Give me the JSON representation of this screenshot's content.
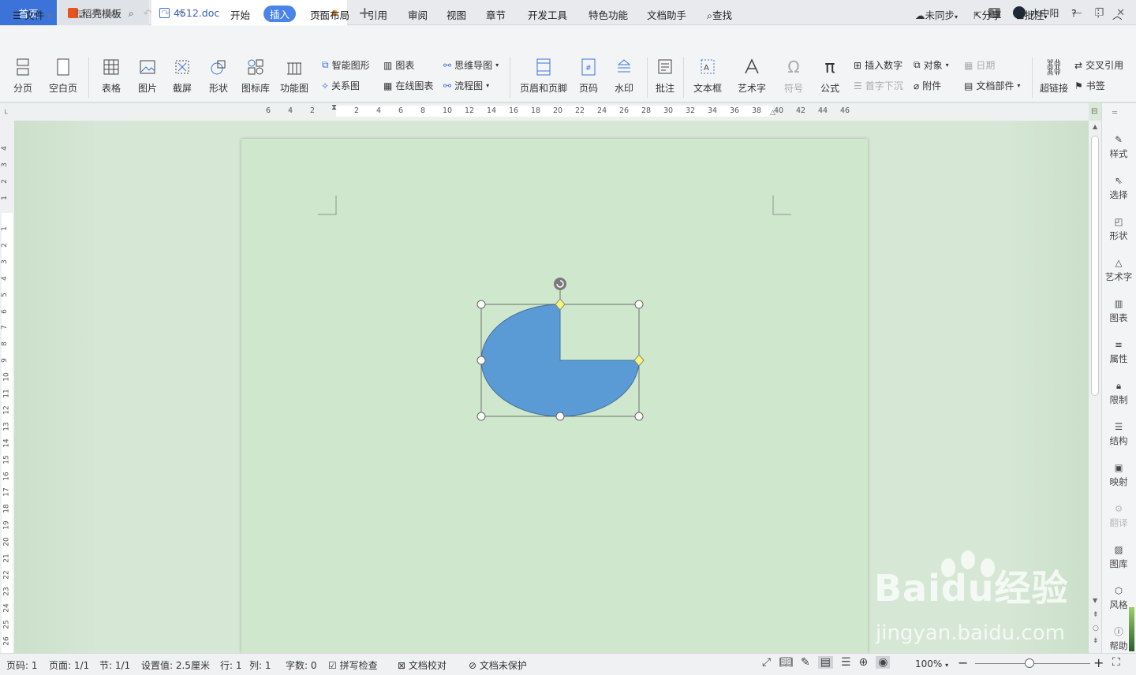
{
  "tabs": {
    "home": "首页",
    "template": "稻壳模板",
    "doc": "4512.doc"
  },
  "window": {
    "badge": "1",
    "user": "水中阳"
  },
  "menu": {
    "file": "文件",
    "items": [
      "开始",
      "插入",
      "页面布局",
      "引用",
      "审阅",
      "视图",
      "章节",
      "开发工具",
      "特色功能",
      "文档助手"
    ],
    "search": "查找",
    "sync": "未同步",
    "share": "分享",
    "comment": "批注",
    "help": "?"
  },
  "ribbon": {
    "page_break": "分页",
    "blank_page": "空白页",
    "table": "表格",
    "picture": "图片",
    "screenshot": "截屏",
    "shape": "形状",
    "icon_lib": "图标库",
    "func_chart": "功能图",
    "smart_shape": "智能图形",
    "chart": "图表",
    "mind_map": "思维导图",
    "relation": "关系图",
    "online_chart": "在线图表",
    "flowchart": "流程图",
    "header_footer": "页眉和页脚",
    "page_num": "页码",
    "watermark": "水印",
    "annotation": "批注",
    "textbox": "文本框",
    "wordart": "艺术字",
    "symbol": "符号",
    "formula": "公式",
    "insert_number": "插入数字",
    "object": "对象",
    "date": "日期",
    "dropcap": "首字下沉",
    "attachment": "附件",
    "doc_parts": "文档部件",
    "hyperlink": "超链接",
    "crossref": "交叉引用",
    "bookmark": "书签"
  },
  "ruler": {
    "h_ticks": [
      "6",
      "4",
      "2",
      "2",
      "4",
      "6",
      "8",
      "10",
      "12",
      "14",
      "16",
      "18",
      "20",
      "22",
      "24",
      "26",
      "28",
      "30",
      "32",
      "34",
      "36",
      "38",
      "40",
      "42",
      "44",
      "46"
    ],
    "v_ticks": [
      "4",
      "3",
      "2",
      "1",
      "1",
      "2",
      "3",
      "4",
      "5",
      "6",
      "7",
      "8",
      "9",
      "10",
      "11",
      "12",
      "13",
      "14",
      "15",
      "16",
      "17",
      "18",
      "19",
      "20",
      "21",
      "22",
      "23",
      "24",
      "25",
      "26"
    ]
  },
  "side_panel": [
    "样式",
    "选择",
    "形状",
    "艺术字",
    "图表",
    "属性",
    "限制",
    "结构",
    "映射",
    "翻译",
    "图库",
    "风格",
    "帮助"
  ],
  "status": {
    "page": "页码: 1",
    "pages": "页面: 1/1",
    "section": "节: 1/1",
    "setting": "设置值: 2.5厘米",
    "row": "行: 1",
    "col": "列: 1",
    "words": "字数: 0",
    "spell": "拼写检查",
    "proof": "文档校对",
    "protect": "文档未保护",
    "zoom": "100%"
  },
  "watermark": {
    "brand": "Baidu经验",
    "url": "jingyan.baidu.com"
  },
  "colors": {
    "accent": "#4a84e8",
    "shape_fill": "#5b9bd5",
    "page_bg": "#cfe7cd"
  }
}
